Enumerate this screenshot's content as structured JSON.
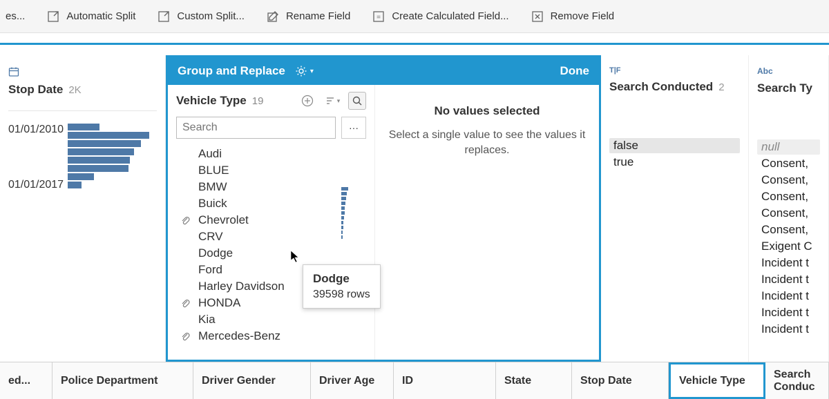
{
  "toolbar": {
    "truncated_left": "es...",
    "automatic_split": "Automatic Split",
    "custom_split": "Custom Split...",
    "rename_field": "Rename Field",
    "create_calc": "Create Calculated Field...",
    "remove_field": "Remove Field"
  },
  "stop_date": {
    "type_label": "date",
    "title": "Stop Date",
    "count": "2K",
    "start": "01/01/2010",
    "end": "01/01/2017",
    "bars": [
      46,
      118,
      106,
      96,
      90,
      88,
      38,
      20
    ]
  },
  "group_panel": {
    "header": "Group and Replace",
    "done": "Done",
    "field_title": "Vehicle Type",
    "field_count": "19",
    "search_placeholder": "Search",
    "right_title": "No values selected",
    "right_sub": "Select a single value to see the values it replaces.",
    "items": [
      {
        "label": "Audi",
        "fill": 40,
        "clip": false
      },
      {
        "label": "BLUE",
        "fill": 0,
        "clip": false
      },
      {
        "label": "BMW",
        "fill": 48,
        "clip": false
      },
      {
        "label": "Buick",
        "fill": 40,
        "clip": false
      },
      {
        "label": "Chevrolet",
        "fill": 180,
        "clip": true
      },
      {
        "label": "CRV",
        "fill": 0,
        "clip": false
      },
      {
        "label": "Dodge",
        "fill": 110,
        "clip": false
      },
      {
        "label": "Ford",
        "fill": 150,
        "clip": false
      },
      {
        "label": "Harley Davidson",
        "fill": 0,
        "clip": false
      },
      {
        "label": "HONDA",
        "fill": 68,
        "clip": true
      },
      {
        "label": "Kia",
        "fill": 0,
        "clip": false
      },
      {
        "label": "Mercedes-Benz",
        "fill": 0,
        "clip": true
      }
    ],
    "minibars": [
      10,
      8,
      7,
      6,
      5,
      5,
      4,
      3,
      3,
      2,
      2
    ],
    "tooltip": {
      "title": "Dodge",
      "rows": "39598 rows"
    }
  },
  "search_conducted": {
    "type_label": "T|F",
    "title": "Search Conducted",
    "count": "2",
    "values": [
      "false",
      "true"
    ]
  },
  "search_type": {
    "type_label": "Abc",
    "title": "Search Ty",
    "values": [
      "null",
      "Consent,",
      "Consent,",
      "Consent,",
      "Consent,",
      "Consent,",
      "Exigent C",
      "Incident t",
      "Incident t",
      "Incident t",
      "Incident t",
      "Incident t"
    ]
  },
  "grid_headers": {
    "c0": "ed...",
    "c1": "Police Department",
    "c2": "Driver Gender",
    "c3": "Driver Age",
    "c4": "ID",
    "c5": "State",
    "c6": "Stop Date",
    "c7": "Vehicle Type",
    "c8": "Search Conduc"
  }
}
